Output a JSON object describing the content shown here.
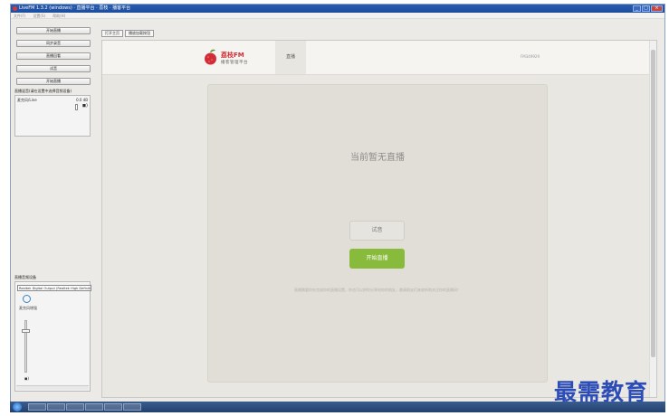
{
  "window": {
    "title": "LiveFM 1.3.2 (windows) · 直播平台 · 荔枝 · 播客平台",
    "controls": [
      "_",
      "□",
      "×"
    ]
  },
  "menu": [
    "文件(F)",
    "设置(S)",
    "帮助(H)"
  ],
  "left_panel": {
    "buttons": [
      "开始直播",
      "同步录音",
      "直播回看",
      "试音",
      "开始直播"
    ],
    "mixer_label": "直播混音(请在设置中选择音频设备)",
    "mixer_row": "麦克风/Line",
    "mixer_value": "0.0 dB",
    "input_label": "直播音频设备",
    "device": "Realtek Digital Output (Realtek High Definition Audio)",
    "mic_label": "麦克风增强"
  },
  "tabs": [
    "打开主页",
    "播放加载按钮"
  ],
  "site": {
    "brand": "荔枝FM",
    "brand_sub": "播客管理平台",
    "nav_live": "直播",
    "fm_id": "FM349929",
    "empty_state": "当前暂无直播",
    "trial_button": "试音",
    "start_button": "开始直播",
    "hint": "直播需要你先完成你的直播设置，你也可以把你分享给你的朋友，邀请朋友们来收听和关注你的直播间！"
  },
  "watermark": "最需教育",
  "colors": {
    "brand_red": "#d22d36",
    "start_green": "#88bb3c",
    "watermark_blue": "#2c4cb8"
  }
}
